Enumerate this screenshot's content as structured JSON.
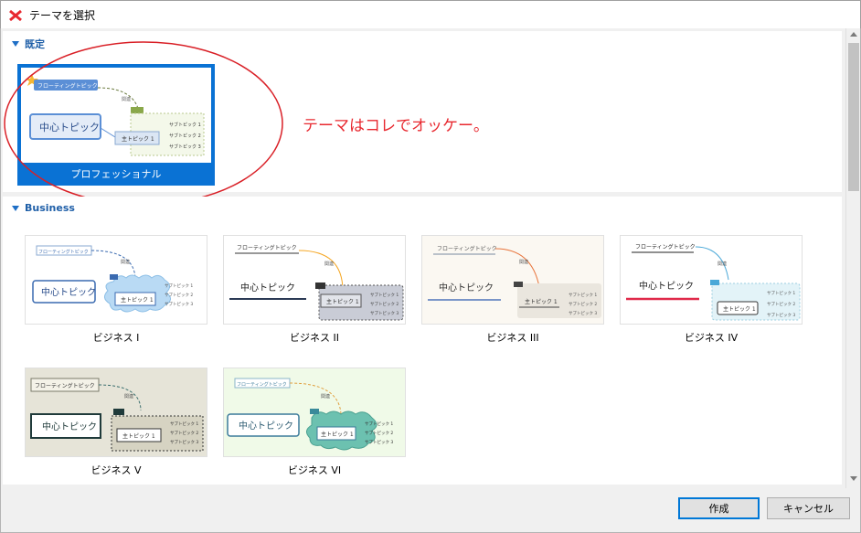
{
  "window": {
    "title": "テーマを選択"
  },
  "sections": [
    {
      "label": "既定"
    },
    {
      "label": "Business"
    }
  ],
  "common": {
    "floating_topic": "フローティングトピック",
    "central_topic": "中心トピック",
    "main_topic": "主トピック 1",
    "subtopics": [
      "サブトピック 1",
      "サブトピック 2",
      "サブトピック 3"
    ],
    "relation": "関連",
    "summary": "基本"
  },
  "default_themes": [
    {
      "name": "プロフェッショナル",
      "selected": true
    }
  ],
  "business_themes": [
    {
      "name": "ビジネス I"
    },
    {
      "name": "ビジネス II"
    },
    {
      "name": "ビジネス III"
    },
    {
      "name": "ビジネス IV"
    },
    {
      "name": "ビジネス V"
    },
    {
      "name": "ビジネス VI"
    }
  ],
  "annotation": "テーマはコレでオッケー。",
  "buttons": {
    "create": "作成",
    "cancel": "キャンセル"
  },
  "colors": {
    "accent": "#0a72d4",
    "annotation": "#e8282f",
    "section_header": "#1f5fa8"
  }
}
